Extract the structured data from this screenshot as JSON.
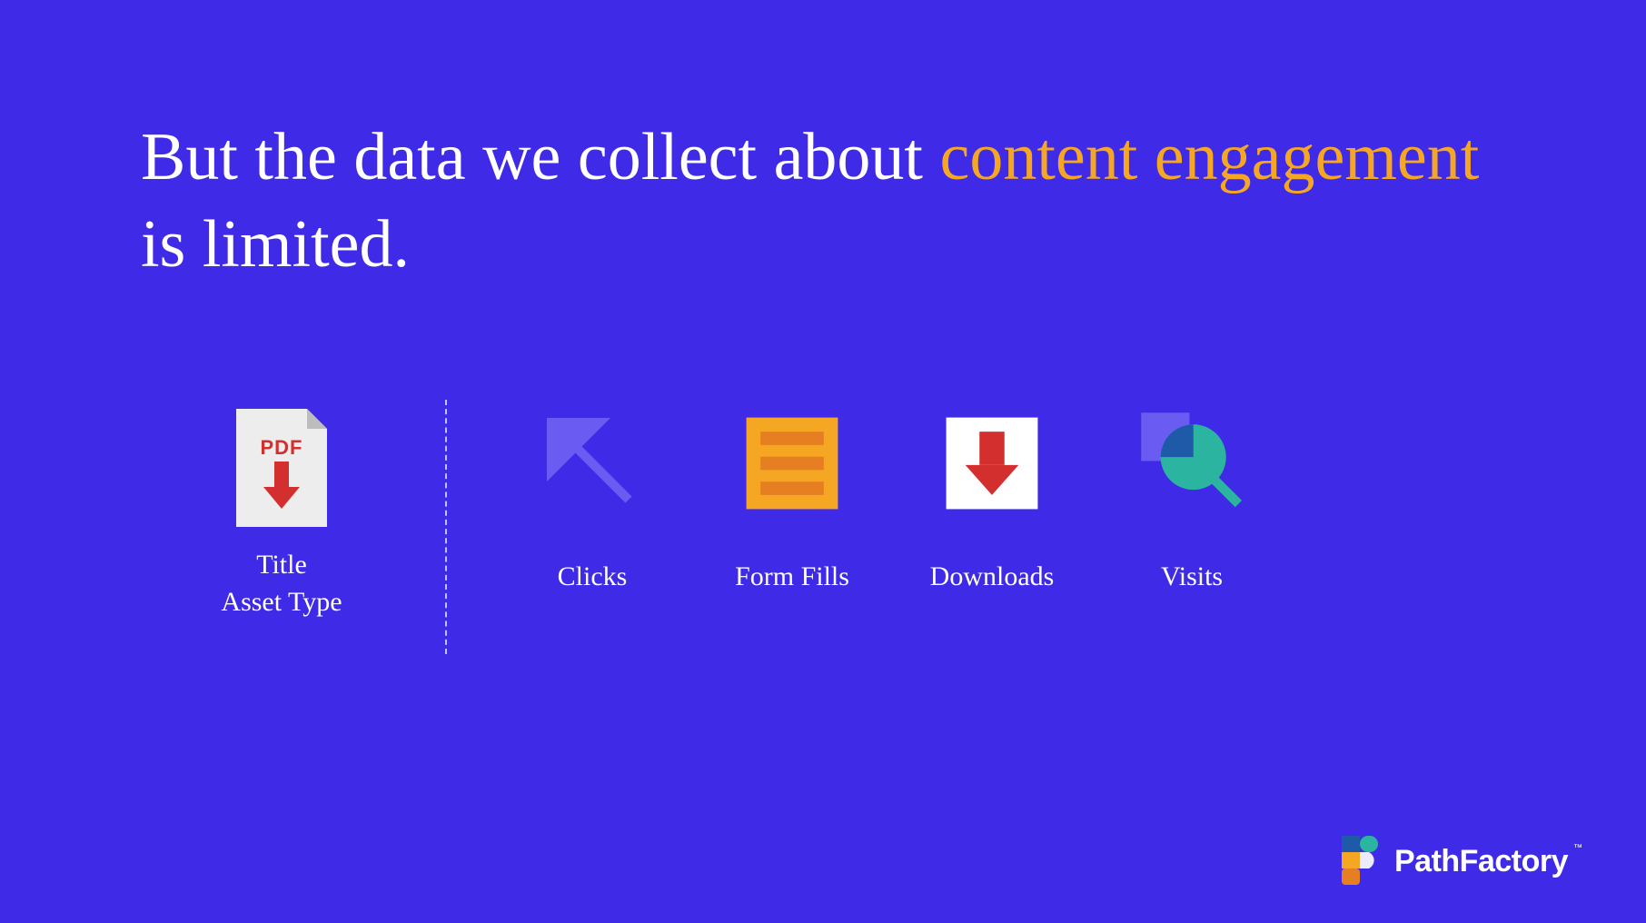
{
  "headline": {
    "part1": "But the data we collect about ",
    "accent": "content engagement",
    "part2": " is limited."
  },
  "asset": {
    "file_type": "PDF",
    "line1": "Title",
    "line2": "Asset Type"
  },
  "metrics": [
    {
      "label": "Clicks",
      "icon": "cursor-arrow-icon"
    },
    {
      "label": "Form Fills",
      "icon": "form-lines-icon"
    },
    {
      "label": "Downloads",
      "icon": "download-arrow-icon"
    },
    {
      "label": "Visits",
      "icon": "magnifier-chart-icon"
    }
  ],
  "brand": {
    "name": "PathFactory",
    "tm": "™"
  },
  "colors": {
    "background": "#3F2BE7",
    "accent": "#F5A623",
    "red": "#D32F2F",
    "orange": "#F5A623",
    "white": "#FFFFFF",
    "teal": "#2BB5A0"
  }
}
